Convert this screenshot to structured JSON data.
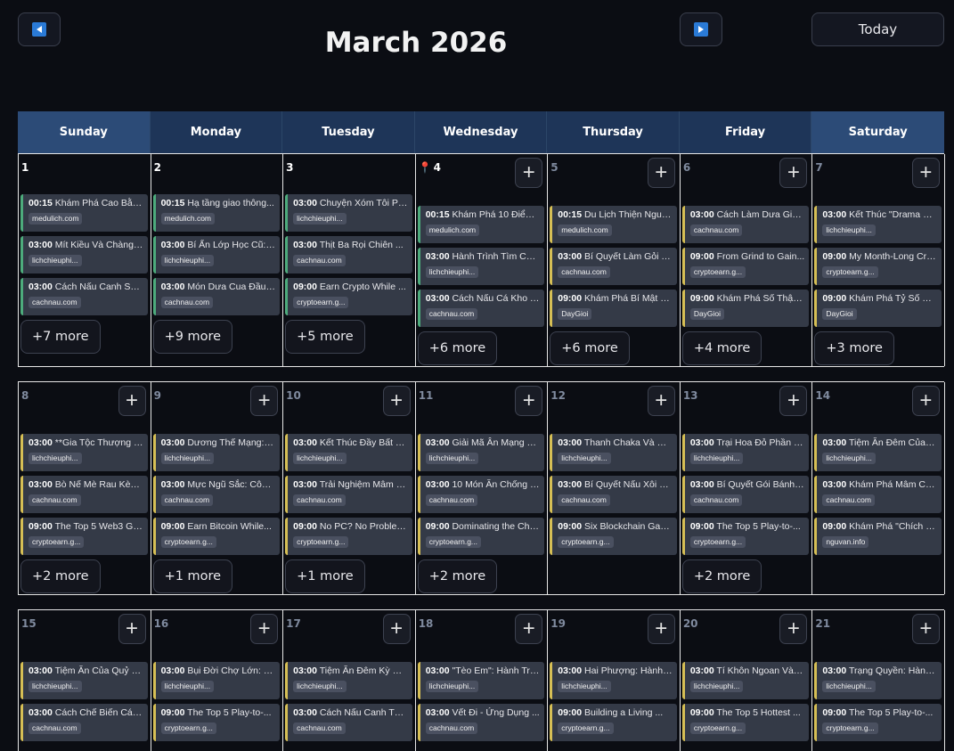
{
  "header": {
    "month_title": "March 2026",
    "today_label": "Today"
  },
  "colors": {
    "header_bg": "#1e3558",
    "weekend_header_bg": "#2c4b77",
    "accent_yellow": "#d6bf55",
    "accent_green": "#4dab7c"
  },
  "weekdays": [
    "Sunday",
    "Monday",
    "Tuesday",
    "Wednesday",
    "Thursday",
    "Friday",
    "Saturday"
  ],
  "weeks": [
    {
      "days": [
        {
          "num": "1",
          "events": [
            {
              "time": "00:15",
              "title": "Khám Phá Cao Bằng:...",
              "tag": "medulich.com",
              "wrap": true,
              "pre": "",
              "accent": "green"
            },
            {
              "time": "03:00",
              "title": "Mít Kiều Và Chàng ...",
              "tag": "lichchieuphi...",
              "wrap": false,
              "accent": "green"
            },
            {
              "time": "03:00",
              "title": "Cách Nấu Canh Sườn...",
              "tag": "cachnau.com",
              "wrap": true,
              "accent": "green"
            }
          ],
          "more": "+7 more"
        },
        {
          "num": "2",
          "events": [
            {
              "time": "00:15",
              "title": "Hạ tầng giao thông...",
              "tag": "medulich.com",
              "wrap": false,
              "accent": "green"
            },
            {
              "time": "03:00",
              "title": "Bí Ẩn Lớp Học Cũ: ...",
              "tag": "lichchieuphi...",
              "wrap": false,
              "accent": "green"
            },
            {
              "time": "03:00",
              "title": "Món Dưa Cua Đầu Nă...",
              "tag": "cachnau.com",
              "wrap": true,
              "accent": "green"
            }
          ],
          "more": "+9 more"
        },
        {
          "num": "3",
          "events": [
            {
              "time": "03:00",
              "title": "Chuyện Xóm Tôi Phầ...",
              "tag": "lichchieuphi...",
              "wrap": true,
              "accent": "green"
            },
            {
              "time": "03:00",
              "title": "Thịt Ba Rọi Chiên ...",
              "tag": "cachnau.com",
              "wrap": false,
              "accent": "green"
            },
            {
              "time": "09:00",
              "title": "Earn Crypto While ...",
              "tag": "cryptoearn.g...",
              "wrap": false,
              "accent": "green"
            }
          ],
          "more": "+5 more"
        },
        {
          "num": "4",
          "pin": "📍",
          "add": "+",
          "events": [
            {
              "time": "00:15",
              "title": "Khám Phá 10 Điểm Đ...",
              "tag": "medulich.com",
              "wrap": true,
              "accent": "green"
            },
            {
              "time": "03:00",
              "title": "Hành Trình Tìm Cha...",
              "tag": "lichchieuphi...",
              "wrap": false,
              "accent": "green"
            },
            {
              "time": "03:00",
              "title": "Cách Nấu Cá Kho Tộ...",
              "tag": "cachnau.com",
              "wrap": false,
              "accent": "green"
            }
          ],
          "more": "+6 more"
        },
        {
          "num": "5",
          "add": "+",
          "events": [
            {
              "time": "00:15",
              "title": "Du Lịch Thiện Nguy...",
              "tag": "medulich.com",
              "wrap": false,
              "accent": "yellow"
            },
            {
              "time": "03:00",
              "title": "Bí Quyết Làm Gỏi T...",
              "tag": "cachnau.com",
              "wrap": false,
              "accent": "yellow"
            },
            {
              "time": "09:00",
              "title": "Khám Phá Bí Mật Số...",
              "tag": "DayGioi",
              "wrap": true,
              "accent": "yellow"
            }
          ],
          "more": "+6 more"
        },
        {
          "num": "6",
          "add": "+",
          "events": [
            {
              "time": "03:00",
              "title": "Cách Làm Dưa Giá H...",
              "tag": "cachnau.com",
              "wrap": true,
              "accent": "yellow"
            },
            {
              "time": "09:00",
              "title": "From Grind to Gain...",
              "tag": "cryptoearn.g...",
              "wrap": false,
              "accent": "yellow"
            },
            {
              "time": "09:00",
              "title": "Khám Phá Số Thập P...",
              "tag": "DayGioi",
              "wrap": true,
              "accent": "yellow"
            }
          ],
          "more": "+4 more"
        },
        {
          "num": "7",
          "add": "+",
          "events": [
            {
              "time": "03:00",
              "title": "Kết Thúc \"Drama Vợ...",
              "tag": "lichchieuphi...",
              "wrap": false,
              "accent": "yellow"
            },
            {
              "time": "09:00",
              "title": "My Month-Long Cryp...",
              "tag": "cryptoearn.g...",
              "wrap": true,
              "accent": "yellow"
            },
            {
              "time": "09:00",
              "title": "Khám Phá Tỷ Số Của...",
              "tag": "DayGioi",
              "wrap": true,
              "accent": "yellow"
            }
          ],
          "more": "+3 more"
        }
      ]
    },
    {
      "days": [
        {
          "num": "8",
          "add": "+",
          "events": [
            {
              "time": "03:00",
              "title": "**Gia Tộc Thượng L...",
              "tag": "lichchieuphi...",
              "wrap": false,
              "accent": "yellow"
            },
            {
              "time": "03:00",
              "title": "Bò Nế Mè Rau Kèn C...",
              "tag": "cachnau.com",
              "wrap": false,
              "accent": "yellow"
            },
            {
              "time": "09:00",
              "title": "The Top 5 Web3 Gam...",
              "tag": "cryptoearn.g...",
              "wrap": true,
              "accent": "yellow"
            }
          ],
          "more": "+2 more"
        },
        {
          "num": "9",
          "add": "+",
          "events": [
            {
              "time": "03:00",
              "title": "Dương Thế Mạng: Hà...",
              "tag": "lichchieuphi...",
              "wrap": true,
              "accent": "yellow"
            },
            {
              "time": "03:00",
              "title": "Mực Ngũ Sắc: Công ...",
              "tag": "cachnau.com",
              "wrap": false,
              "accent": "yellow"
            },
            {
              "time": "09:00",
              "title": "Earn Bitcoin While...",
              "tag": "cryptoearn.g...",
              "wrap": false,
              "accent": "yellow"
            }
          ],
          "more": "+1 more"
        },
        {
          "num": "10",
          "add": "+",
          "events": [
            {
              "time": "03:00",
              "title": "Kết Thúc Đầy Bất N...",
              "tag": "lichchieuphi...",
              "wrap": false,
              "accent": "yellow"
            },
            {
              "time": "03:00",
              "title": "Trải Nghiệm Mâm Cỗ...",
              "tag": "cachnau.com",
              "wrap": true,
              "accent": "yellow"
            },
            {
              "time": "09:00",
              "title": "No PC? No Problem!...",
              "tag": "cryptoearn.g...",
              "wrap": true,
              "accent": "yellow"
            }
          ],
          "more": "+1 more"
        },
        {
          "num": "11",
          "add": "+",
          "events": [
            {
              "time": "03:00",
              "title": "Giải Mã Ân Mạng Và...",
              "tag": "lichchieuphi...",
              "wrap": false,
              "accent": "yellow"
            },
            {
              "time": "03:00",
              "title": "10 Món Ăn Chống Ng...",
              "tag": "cachnau.com",
              "wrap": true,
              "accent": "yellow"
            },
            {
              "time": "09:00",
              "title": "Dominating the Cha...",
              "tag": "cryptoearn.g...",
              "wrap": false,
              "accent": "yellow"
            }
          ],
          "more": "+2 more"
        },
        {
          "num": "12",
          "add": "+",
          "events": [
            {
              "time": "03:00",
              "title": "Thanh Chaka Và Vụ ...",
              "tag": "lichchieuphi...",
              "wrap": false,
              "accent": "yellow"
            },
            {
              "time": "03:00",
              "title": "Bí Quyết Nấu Xôi G...",
              "tag": "cachnau.com",
              "wrap": false,
              "accent": "yellow"
            },
            {
              "time": "09:00",
              "title": "Six Blockchain Gam...",
              "tag": "cryptoearn.g...",
              "wrap": false,
              "accent": "yellow"
            }
          ],
          "more": ""
        },
        {
          "num": "13",
          "add": "+",
          "events": [
            {
              "time": "03:00",
              "title": "Trại Hoa Đỏ Phần 1...",
              "tag": "lichchieuphi...",
              "wrap": false,
              "accent": "yellow"
            },
            {
              "time": "03:00",
              "title": "Bí Quyết Gói Bánh ...",
              "tag": "cachnau.com",
              "wrap": false,
              "accent": "yellow"
            },
            {
              "time": "09:00",
              "title": "The Top 5 Play-to-...",
              "tag": "cryptoearn.g...",
              "wrap": false,
              "accent": "yellow"
            }
          ],
          "more": "+2 more"
        },
        {
          "num": "14",
          "add": "+",
          "events": [
            {
              "time": "03:00",
              "title": "Tiệm Ăn Đêm Của Qu...",
              "tag": "lichchieuphi...",
              "wrap": true,
              "accent": "yellow"
            },
            {
              "time": "03:00",
              "title": "Khám Phá Mâm Cỗ Tế...",
              "tag": "cachnau.com",
              "wrap": true,
              "accent": "yellow"
            },
            {
              "time": "09:00",
              "title": "Khám Phá \"Chích Hộ...",
              "tag": "nguvan.info",
              "wrap": true,
              "accent": "yellow"
            }
          ],
          "more": ""
        }
      ]
    },
    {
      "days": [
        {
          "num": "15",
          "add": "+",
          "events": [
            {
              "time": "03:00",
              "title": "Tiệm Ăn Của Quỷ Ph...",
              "tag": "lichchieuphi...",
              "wrap": true,
              "accent": "yellow"
            },
            {
              "time": "03:00",
              "title": "Cách Chế Biến Cá T...",
              "tag": "cachnau.com",
              "wrap": false,
              "accent": "yellow"
            }
          ],
          "more": ""
        },
        {
          "num": "16",
          "add": "+",
          "events": [
            {
              "time": "03:00",
              "title": "Bụi Đời Chợ Lớn: C...",
              "tag": "lichchieuphi...",
              "wrap": false,
              "accent": "yellow"
            },
            {
              "time": "09:00",
              "title": "The Top 5 Play-to-...",
              "tag": "cryptoearn.g...",
              "wrap": false,
              "accent": "yellow"
            }
          ],
          "more": ""
        },
        {
          "num": "17",
          "add": "+",
          "events": [
            {
              "time": "03:00",
              "title": "Tiệm Ăn Đêm Kỳ Bí:...",
              "tag": "lichchieuphi...",
              "wrap": false,
              "accent": "yellow"
            },
            {
              "time": "03:00",
              "title": "Cách Nấu Canh Tôm ...",
              "tag": "cachnau.com",
              "wrap": true,
              "accent": "yellow"
            }
          ],
          "more": ""
        },
        {
          "num": "18",
          "add": "+",
          "events": [
            {
              "time": "03:00",
              "title": "\"Tèo Em\": Hành Trì...",
              "tag": "lichchieuphi...",
              "wrap": false,
              "accent": "yellow"
            },
            {
              "time": "03:00",
              "title": "Vết Đi - Ứng Dụng ...",
              "tag": "cachnau.com",
              "wrap": false,
              "accent": "yellow"
            }
          ],
          "more": ""
        },
        {
          "num": "19",
          "add": "+",
          "events": [
            {
              "time": "03:00",
              "title": "Hai Phượng: Hành T...",
              "tag": "lichchieuphi...",
              "wrap": false,
              "accent": "yellow"
            },
            {
              "time": "09:00",
              "title": "Building a Living ...",
              "tag": "cryptoearn.g...",
              "wrap": false,
              "accent": "yellow"
            }
          ],
          "more": ""
        },
        {
          "num": "20",
          "add": "+",
          "events": [
            {
              "time": "03:00",
              "title": "Tí Khôn Ngoan Và H...",
              "tag": "lichchieuphi...",
              "wrap": false,
              "accent": "yellow"
            },
            {
              "time": "09:00",
              "title": "The Top 5 Hottest ...",
              "tag": "cryptoearn.g...",
              "wrap": false,
              "accent": "yellow"
            }
          ],
          "more": ""
        },
        {
          "num": "21",
          "add": "+",
          "events": [
            {
              "time": "03:00",
              "title": "Trạng Quyền: Hành ...",
              "tag": "lichchieuphi...",
              "wrap": false,
              "accent": "yellow"
            },
            {
              "time": "09:00",
              "title": "The Top 5 Play-to-...",
              "tag": "cryptoearn.g...",
              "wrap": false,
              "accent": "yellow"
            }
          ],
          "more": ""
        }
      ]
    }
  ]
}
